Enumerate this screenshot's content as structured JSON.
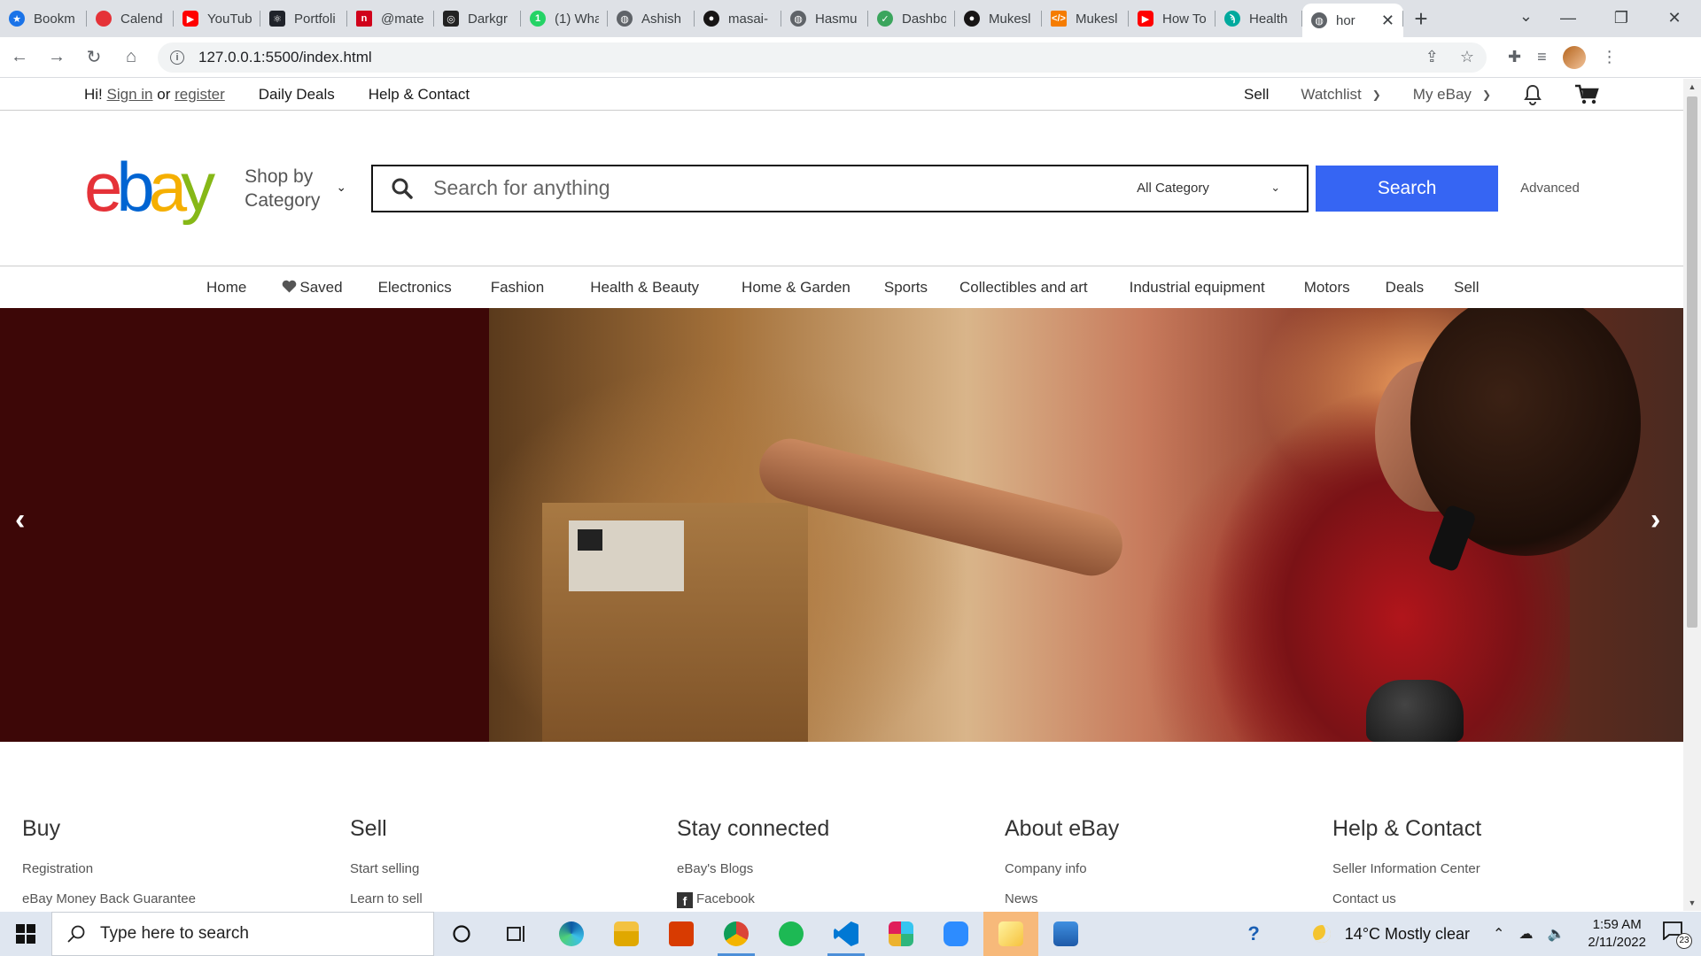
{
  "browser": {
    "tabs": [
      {
        "label": "Bookm",
        "favicon_color": "#1a73e8",
        "icon": "star-icon"
      },
      {
        "label": "Calend",
        "favicon_color": "#e53238",
        "icon": "calendar-icon"
      },
      {
        "label": "YouTub",
        "favicon_color": "#ff0000",
        "icon": "youtube-icon"
      },
      {
        "label": "Portfoli",
        "favicon_color": "#20232a",
        "icon": "react-icon"
      },
      {
        "label": "@mate",
        "favicon_color": "#d0021b",
        "icon": "brand-icon"
      },
      {
        "label": "Darkgr",
        "favicon_color": "#222222",
        "icon": "brand-icon"
      },
      {
        "label": "(1) Wha",
        "favicon_color": "#25d366",
        "icon": "whatsapp-icon"
      },
      {
        "label": "Ashish",
        "favicon_color": "#5f6368",
        "icon": "globe-icon"
      },
      {
        "label": "masai-",
        "favicon_color": "#171515",
        "icon": "github-icon"
      },
      {
        "label": "Hasmu",
        "favicon_color": "#5f6368",
        "icon": "globe-icon"
      },
      {
        "label": "Dashbo",
        "favicon_color": "#3ba55d",
        "icon": "check-icon"
      },
      {
        "label": "Mukesl",
        "favicon_color": "#171515",
        "icon": "github-icon"
      },
      {
        "label": "Mukesl",
        "favicon_color": "#f57c00",
        "icon": "code-icon"
      },
      {
        "label": "How To",
        "favicon_color": "#ff0000",
        "icon": "youtube-icon"
      },
      {
        "label": "Health",
        "favicon_color": "#00a99d",
        "icon": "brand-icon"
      }
    ],
    "active_tab": {
      "label": "hor",
      "close": "✕"
    },
    "new_tab": "+",
    "url": "127.0.0.1:5500/index.html",
    "window_controls": {
      "minimize": "—",
      "maximize": "❐",
      "close": "✕"
    }
  },
  "utility_bar": {
    "greeting": "Hi!",
    "sign_in": "Sign in",
    "or": "or",
    "register": "register",
    "daily_deals": "Daily Deals",
    "help_contact": "Help & Contact",
    "sell": "Sell",
    "watchlist": "Watchlist",
    "my_ebay": "My eBay"
  },
  "header": {
    "logo": {
      "e": "e",
      "b": "b",
      "a": "a",
      "y": "y"
    },
    "shop_by": "Shop by",
    "category": "Category",
    "search_placeholder": "Search for anything",
    "category_select": "All Category",
    "search_button": "Search",
    "advanced": "Advanced"
  },
  "nav": {
    "items": [
      "Home",
      "Saved",
      "Electronics",
      "Fashion",
      "Health & Beauty",
      "Home & Garden",
      "Sports",
      "Collectibles and art",
      "Industrial equipment",
      "Motors",
      "Deals",
      "Sell"
    ]
  },
  "hero": {
    "prev": "‹",
    "next": "›"
  },
  "footer": {
    "columns": [
      {
        "title": "Buy",
        "links": [
          "Registration",
          "eBay Money Back Guarantee"
        ]
      },
      {
        "title": "Sell",
        "links": [
          "Start selling",
          "Learn to sell"
        ]
      },
      {
        "title": "Stay connected",
        "links": [
          "eBay's Blogs",
          "Facebook"
        ]
      },
      {
        "title": "About eBay",
        "links": [
          "Company info",
          "News"
        ]
      },
      {
        "title": "Help & Contact",
        "links": [
          "Seller Information Center",
          "Contact us"
        ]
      }
    ]
  },
  "taskbar": {
    "search_placeholder": "Type here to search",
    "weather": "14°C  Mostly clear",
    "time": "1:59 AM",
    "date": "2/11/2022",
    "notification_count": "23"
  }
}
